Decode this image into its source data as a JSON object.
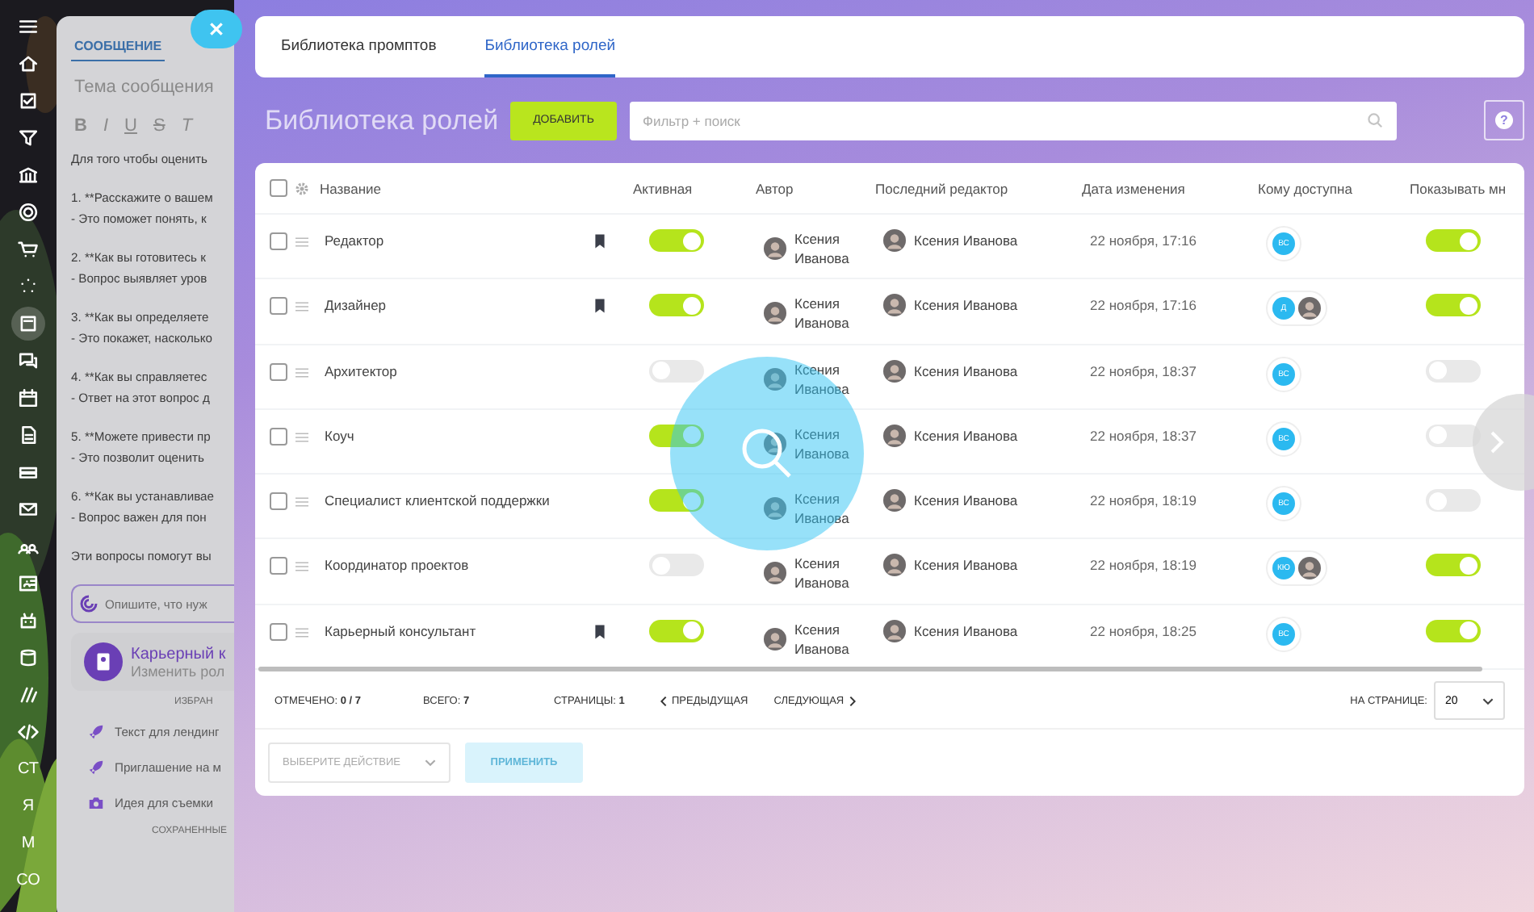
{
  "sidebar": {
    "text_items": [
      "СТ",
      "Я",
      "М",
      "СО"
    ]
  },
  "message_panel": {
    "tab": "СООБЩЕНИЕ",
    "subject_placeholder": "Тема сообщения",
    "format_buttons": [
      "B",
      "I",
      "U",
      "S",
      "T"
    ],
    "body": [
      [
        "Для того чтобы оценить"
      ],
      [
        "1. **Расскажите о вашем",
        "- Это поможет понять, к"
      ],
      [
        "2. **Как вы готовитесь к",
        "- Вопрос выявляет уров"
      ],
      [
        "3. **Как вы определяете",
        "- Это покажет, насколько"
      ],
      [
        "4. **Как вы справляетес",
        "- Ответ на этот вопрос д"
      ],
      [
        "5. **Можете привести пр",
        "- Это позволит оценить"
      ],
      [
        "6. **Как вы устанавливае",
        "- Вопрос важен для пон"
      ],
      [
        "Эти вопросы помогут вы"
      ]
    ],
    "prompt_placeholder": "Опишите, что нуж",
    "role_card": {
      "title": "Карьерный к",
      "subtitle": "Изменить рол"
    },
    "favorites_label": "ИЗБРАН",
    "favorites": [
      {
        "kind": "rocket",
        "text": "Текст для лендинг"
      },
      {
        "kind": "rocket",
        "text": "Приглашение на м"
      },
      {
        "kind": "camera",
        "text": "Идея для съемки"
      }
    ],
    "saved_label": "СОХРАНЕННЫЕ"
  },
  "tabs": [
    {
      "label": "Библиотека промптов",
      "selected": false
    },
    {
      "label": "Библиотека ролей",
      "selected": true
    }
  ],
  "page_title": "Библиотека ролей",
  "add_button": "ДОБАВИТЬ",
  "search": {
    "placeholder": "Фильтр + поиск"
  },
  "help_button": "?",
  "table": {
    "header_checked": false,
    "columns": [
      "Название",
      "Активная",
      "Автор",
      "Последний редактор",
      "Дата изменения",
      "Кому доступна",
      "Показывать мн"
    ],
    "rows": [
      {
        "checked": false,
        "name": "Редактор",
        "bookmarked": true,
        "active": true,
        "author": "Ксения Иванова",
        "editor": "Ксения Иванова",
        "date": "22 ноября, 17:16",
        "access": [
          {
            "kind": "initials",
            "text": "ВС"
          }
        ],
        "show_me": true
      },
      {
        "checked": false,
        "name": "Дизайнер",
        "bookmarked": true,
        "active": true,
        "author": "Ксения Иванова",
        "editor": "Ксения Иванова",
        "date": "22 ноября, 17:16",
        "access": [
          {
            "kind": "initials",
            "text": "Д"
          },
          {
            "kind": "avatar"
          }
        ],
        "show_me": true
      },
      {
        "checked": false,
        "name": "Архитектор",
        "bookmarked": false,
        "active": false,
        "author": "Ксения Иванова",
        "editor": "Ксения Иванова",
        "date": "22 ноября, 18:37",
        "access": [
          {
            "kind": "initials",
            "text": "ВС"
          }
        ],
        "show_me": false
      },
      {
        "checked": false,
        "name": "Коуч",
        "bookmarked": false,
        "active": true,
        "author": "Ксения Иванова",
        "editor": "Ксения Иванова",
        "date": "22 ноября, 18:37",
        "access": [
          {
            "kind": "initials",
            "text": "ВС"
          }
        ],
        "show_me": false
      },
      {
        "checked": false,
        "name": "Специалист клиентской поддержки",
        "bookmarked": false,
        "active": true,
        "author": "Ксения Иванова",
        "editor": "Ксения Иванова",
        "date": "22 ноября, 18:19",
        "access": [
          {
            "kind": "initials",
            "text": "ВС"
          }
        ],
        "show_me": false
      },
      {
        "checked": false,
        "name": "Координатор проектов",
        "bookmarked": false,
        "active": false,
        "author": "Ксения Иванова",
        "editor": "Ксения Иванова",
        "date": "22 ноября, 18:19",
        "access": [
          {
            "kind": "initials",
            "text": "КЮ"
          },
          {
            "kind": "avatar"
          }
        ],
        "show_me": true
      },
      {
        "checked": false,
        "name": "Карьерный консультант",
        "bookmarked": true,
        "active": true,
        "author": "Ксения Иванова",
        "editor": "Ксения Иванова",
        "date": "22 ноября, 18:25",
        "access": [
          {
            "kind": "initials",
            "text": "ВС"
          }
        ],
        "show_me": true
      }
    ]
  },
  "footer": {
    "marked": "ОТМЕЧЕНО: **0 / 7**",
    "total": "ВСЕГО: **7**",
    "pages": "СТРАНИЦЫ: **1**",
    "prev": "ПРЕДЫДУЩАЯ",
    "next": "СЛЕДУЮЩАЯ",
    "per_page_label": "НА СТРАНИЦЕ:",
    "per_page": "20"
  },
  "actions": {
    "select_placeholder": "ВЫБЕРИТЕ ДЕЙСТВИЕ",
    "apply_button": "ПРИМЕНИТЬ",
    "apply_disabled": true
  }
}
